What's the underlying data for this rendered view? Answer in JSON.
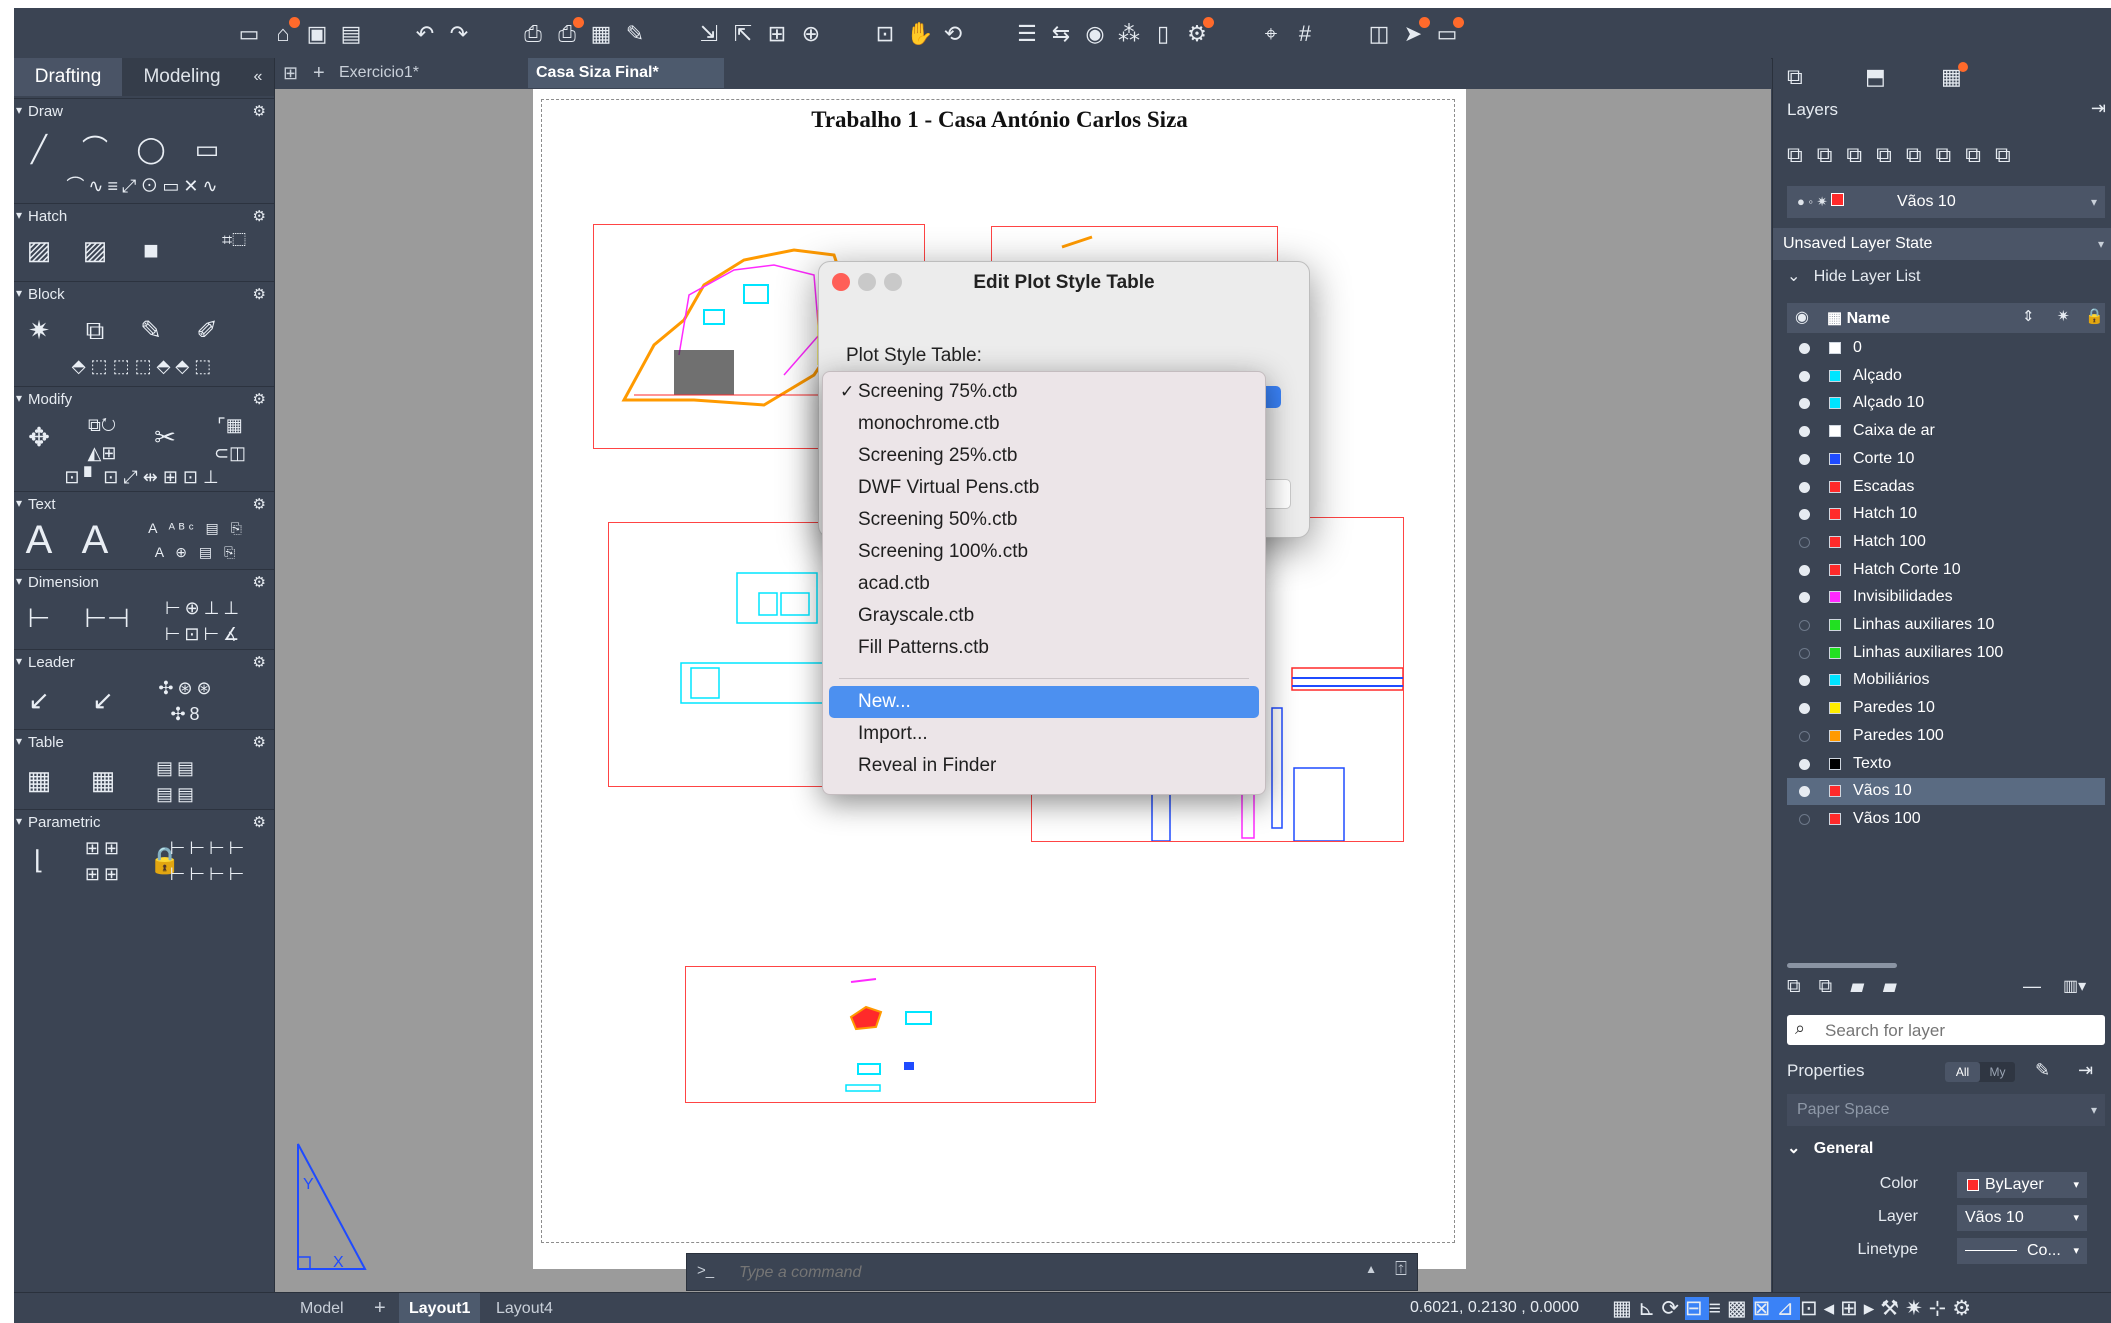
{
  "toolbar": {
    "icons": [
      "new-icon",
      "open-icon",
      "save-icon",
      "save-as-icon",
      "undo-icon",
      "redo-icon",
      "plot-icon",
      "batch-plot-icon",
      "publish-icon",
      "page-setup-icon",
      "import-icon",
      "export-icon",
      "attach-icon",
      "web-icon",
      "zoom-icon",
      "pan-icon",
      "orbit-icon",
      "properties-icon",
      "match-icon",
      "quick-icon",
      "tool-icon",
      "layout-icon",
      "lock-icon",
      "measure-icon",
      "count-icon",
      "split-icon",
      "share-icon",
      "markup-icon"
    ]
  },
  "workspace": {
    "tabs": [
      "Drafting",
      "Modeling"
    ],
    "collapse": "«"
  },
  "palette": {
    "sections": [
      "Draw",
      "Hatch",
      "Block",
      "Modify",
      "Text",
      "Dimension",
      "Leader",
      "Table",
      "Parametric"
    ]
  },
  "doc_tabs": {
    "tabs": [
      "Exercicio1*",
      "Casa Siza Final*"
    ]
  },
  "sheet": {
    "title": "Trabalho 1 - Casa António Carlos Siza"
  },
  "command": {
    "prompt": ">_",
    "placeholder": "Type a command"
  },
  "status": {
    "layout_tabs": [
      "Model",
      "Layout1",
      "Layout4"
    ],
    "active_tab": "Layout1",
    "coords": "0.6021,   0.2130  , 0.0000"
  },
  "dialog": {
    "title": "Edit Plot Style Table",
    "label": "Plot Style Table:"
  },
  "menu": {
    "items": [
      "Screening 75%.ctb",
      "monochrome.ctb",
      "Screening 25%.ctb",
      "DWF Virtual Pens.ctb",
      "Screening 50%.ctb",
      "Screening 100%.ctb",
      "acad.ctb",
      "Grayscale.ctb",
      "Fill Patterns.ctb"
    ],
    "checked": "Screening 75%.ctb",
    "actions": [
      "New...",
      "Import...",
      "Reveal in Finder"
    ],
    "highlighted": "New..."
  },
  "layers_panel": {
    "title": "Layers",
    "current_layer": "Vãos 10",
    "layer_state": "Unsaved Layer State",
    "hide_list": "Hide Layer List",
    "column_name": "Name",
    "search_placeholder": "Search for layer",
    "layers": [
      {
        "name": "0",
        "color": "#ffffff",
        "on": true
      },
      {
        "name": "Alçado",
        "color": "#00e5ff",
        "on": true
      },
      {
        "name": "Alçado 10",
        "color": "#00e5ff",
        "on": true
      },
      {
        "name": "Caixa de ar",
        "color": "#ffffff",
        "on": true
      },
      {
        "name": "Corte 10",
        "color": "#1f4bff",
        "on": true
      },
      {
        "name": "Escadas",
        "color": "#ff2a2a",
        "on": true
      },
      {
        "name": "Hatch 10",
        "color": "#ff2a2a",
        "on": true
      },
      {
        "name": "Hatch 100",
        "color": "#ff2a2a",
        "on": false
      },
      {
        "name": "Hatch Corte 10",
        "color": "#ff2a2a",
        "on": true
      },
      {
        "name": "Invisibilidades",
        "color": "#ff2aff",
        "on": true
      },
      {
        "name": "Linhas auxiliares 10",
        "color": "#22e022",
        "on": false
      },
      {
        "name": "Linhas auxiliares 100",
        "color": "#22e022",
        "on": false
      },
      {
        "name": "Mobiliários",
        "color": "#00e5ff",
        "on": true
      },
      {
        "name": "Paredes 10",
        "color": "#ffee00",
        "on": true
      },
      {
        "name": "Paredes 100",
        "color": "#ff9a00",
        "on": false
      },
      {
        "name": "Texto",
        "color": "#000000",
        "on": true
      },
      {
        "name": "Vãos 10",
        "color": "#ff2a2a",
        "on": true
      },
      {
        "name": "Vãos 100",
        "color": "#ff2a2a",
        "on": false
      }
    ],
    "selected_layer": "Vãos 10"
  },
  "properties_panel": {
    "title": "Properties",
    "filter_all": "All",
    "filter_my": "My",
    "object": "Paper Space",
    "group": "General",
    "rows": [
      {
        "key": "Color",
        "value": "ByLayer",
        "swatch": "#ff2a2a"
      },
      {
        "key": "Layer",
        "value": "Vãos 10"
      },
      {
        "key": "Linetype",
        "value": "Co..."
      }
    ]
  },
  "colors": {
    "accent": "#4c90f0",
    "viewport_border": "#ff4444",
    "ui_bg": "#3b4453"
  }
}
